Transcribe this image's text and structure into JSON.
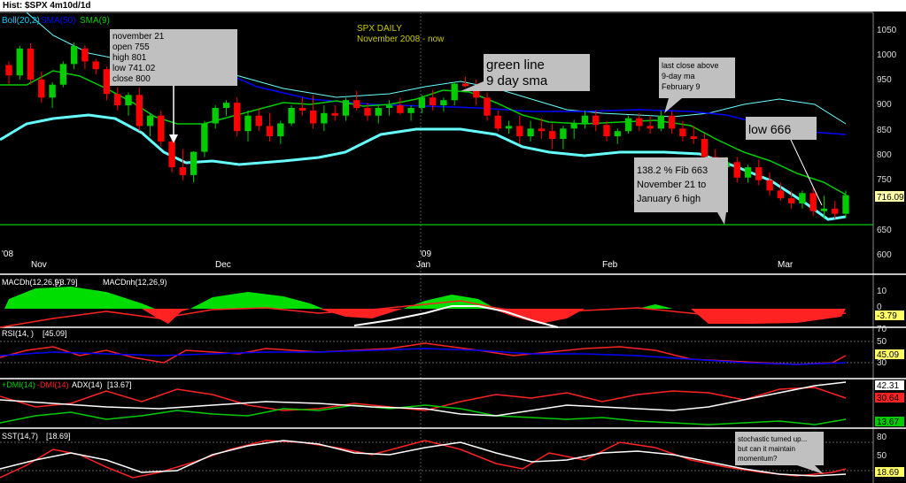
{
  "window_title": "Hist: $SPX 4m10d/1d",
  "chart_title": "SPX DAILY",
  "chart_subtitle": "November 2008 - now",
  "legend": {
    "boll": "Boll(20,2)",
    "sma50": "SMA(50)",
    "sma9": "SMA(9)"
  },
  "price_axis": {
    "ticks": [
      "1050",
      "1000",
      "950",
      "900",
      "850",
      "800",
      "750",
      "700",
      "650",
      "600"
    ],
    "last_label": "716.09"
  },
  "date_labels": {
    "y08": "'08",
    "nov": "Nov",
    "dec": "Dec",
    "y09": "'09",
    "jan": "Jan",
    "feb": "Feb",
    "mar": "Mar"
  },
  "annotations": {
    "nov21": [
      "november 21",
      "open 755",
      "high 801",
      "low 741.02",
      "close 800"
    ],
    "green_line": [
      "green line",
      "9 day sma"
    ],
    "last_close": [
      "last close above",
      "9-day ma",
      "February 9"
    ],
    "low": "low    666",
    "fib": [
      "138.2 % Fib  663",
      "November 21 to",
      "January 6  high"
    ],
    "stoch": [
      "stochastic turned up...",
      "but can it maintain",
      "momentum?"
    ]
  },
  "macd": {
    "label_a": "MACDh(12,26,9)",
    "value_a": "[-3.79]",
    "label_b": "MACDnh(12,26,9)",
    "ticks": [
      "10",
      "0",
      "-10"
    ],
    "last": "-3.79"
  },
  "rsi": {
    "label": "RSI(14,  )",
    "value": "[45.09]",
    "ticks": [
      "70",
      "50",
      "30"
    ],
    "last": "45.09"
  },
  "dmi": {
    "label_plus": "+DMI(14)",
    "label_minus": "-DMI(14)",
    "label_adx": "ADX(14)",
    "value": "[13.67]",
    "ticks": [
      "40",
      "30",
      "20",
      "10"
    ],
    "last_adx": "42.31",
    "last_minus": "30.64",
    "last_plus": "13.67"
  },
  "sst": {
    "label": "SST(14,7)",
    "value": "[18.69]",
    "ticks": [
      "80",
      "50",
      "20"
    ],
    "last": "18.69"
  },
  "colors": {
    "up": "#00cc00",
    "down": "#ff0000",
    "sma9": "#00cc00",
    "sma50": "#0000ff",
    "boll": "#66ffff",
    "signal": "#ffffff"
  },
  "chart_data": {
    "type": "candlestick",
    "title": "SPX DAILY",
    "subtitle": "November 2008 - now",
    "ylim": [
      580,
      1070
    ],
    "x_first_label": "Nov 3 2008",
    "candles": [
      [
        968,
        975,
        930,
        948
      ],
      [
        948,
        1005,
        940,
        1000
      ],
      [
        1000,
        1010,
        930,
        940
      ],
      [
        940,
        955,
        895,
        905
      ],
      [
        905,
        935,
        885,
        930
      ],
      [
        930,
        975,
        925,
        970
      ],
      [
        970,
        1012,
        960,
        1005
      ],
      [
        1000,
        1006,
        960,
        975
      ],
      [
        975,
        980,
        950,
        960
      ],
      [
        960,
        965,
        900,
        912
      ],
      [
        912,
        925,
        880,
        890
      ],
      [
        890,
        915,
        870,
        910
      ],
      [
        910,
        925,
        840,
        850
      ],
      [
        850,
        875,
        830,
        870
      ],
      [
        870,
        880,
        810,
        820
      ],
      [
        820,
        830,
        760,
        770
      ],
      [
        770,
        805,
        745,
        755
      ],
      [
        755,
        801,
        741,
        800
      ],
      [
        800,
        860,
        790,
        855
      ],
      [
        855,
        890,
        845,
        885
      ],
      [
        885,
        900,
        870,
        895
      ],
      [
        895,
        905,
        830,
        840
      ],
      [
        840,
        880,
        820,
        870
      ],
      [
        870,
        885,
        840,
        850
      ],
      [
        850,
        875,
        820,
        830
      ],
      [
        830,
        860,
        815,
        855
      ],
      [
        855,
        890,
        850,
        885
      ],
      [
        885,
        905,
        870,
        880
      ],
      [
        880,
        910,
        845,
        855
      ],
      [
        855,
        890,
        840,
        875
      ],
      [
        875,
        890,
        860,
        870
      ],
      [
        870,
        905,
        860,
        900
      ],
      [
        900,
        918,
        880,
        885
      ],
      [
        885,
        895,
        860,
        870
      ],
      [
        870,
        890,
        855,
        885
      ],
      [
        885,
        900,
        870,
        890
      ],
      [
        890,
        905,
        872,
        875
      ],
      [
        875,
        890,
        860,
        885
      ],
      [
        885,
        910,
        875,
        905
      ],
      [
        905,
        920,
        880,
        890
      ],
      [
        890,
        905,
        878,
        900
      ],
      [
        900,
        935,
        890,
        932
      ],
      [
        932,
        945,
        925,
        927
      ],
      [
        927,
        940,
        890,
        905
      ],
      [
        905,
        915,
        860,
        870
      ],
      [
        870,
        880,
        840,
        845
      ],
      [
        845,
        860,
        835,
        850
      ],
      [
        850,
        870,
        815,
        830
      ],
      [
        830,
        860,
        820,
        845
      ],
      [
        845,
        865,
        825,
        840
      ],
      [
        840,
        855,
        805,
        825
      ],
      [
        825,
        850,
        805,
        845
      ],
      [
        845,
        862,
        825,
        855
      ],
      [
        855,
        880,
        845,
        870
      ],
      [
        870,
        880,
        840,
        852
      ],
      [
        852,
        860,
        820,
        830
      ],
      [
        830,
        845,
        815,
        840
      ],
      [
        840,
        870,
        835,
        865
      ],
      [
        865,
        875,
        840,
        850
      ],
      [
        850,
        870,
        835,
        845
      ],
      [
        845,
        880,
        840,
        870
      ],
      [
        870,
        878,
        835,
        845
      ],
      [
        845,
        860,
        820,
        830
      ],
      [
        830,
        850,
        815,
        825
      ],
      [
        825,
        835,
        780,
        790
      ],
      [
        790,
        805,
        765,
        770
      ],
      [
        770,
        790,
        750,
        780
      ],
      [
        780,
        790,
        740,
        750
      ],
      [
        750,
        775,
        740,
        770
      ],
      [
        770,
        785,
        735,
        745
      ],
      [
        745,
        760,
        715,
        725
      ],
      [
        725,
        740,
        705,
        710
      ],
      [
        710,
        725,
        690,
        700
      ],
      [
        700,
        725,
        690,
        720
      ],
      [
        720,
        730,
        675,
        685
      ],
      [
        685,
        715,
        670,
        690
      ],
      [
        690,
        705,
        670,
        680
      ],
      [
        680,
        725,
        672,
        716
      ]
    ],
    "horizontal_line": 666
  }
}
